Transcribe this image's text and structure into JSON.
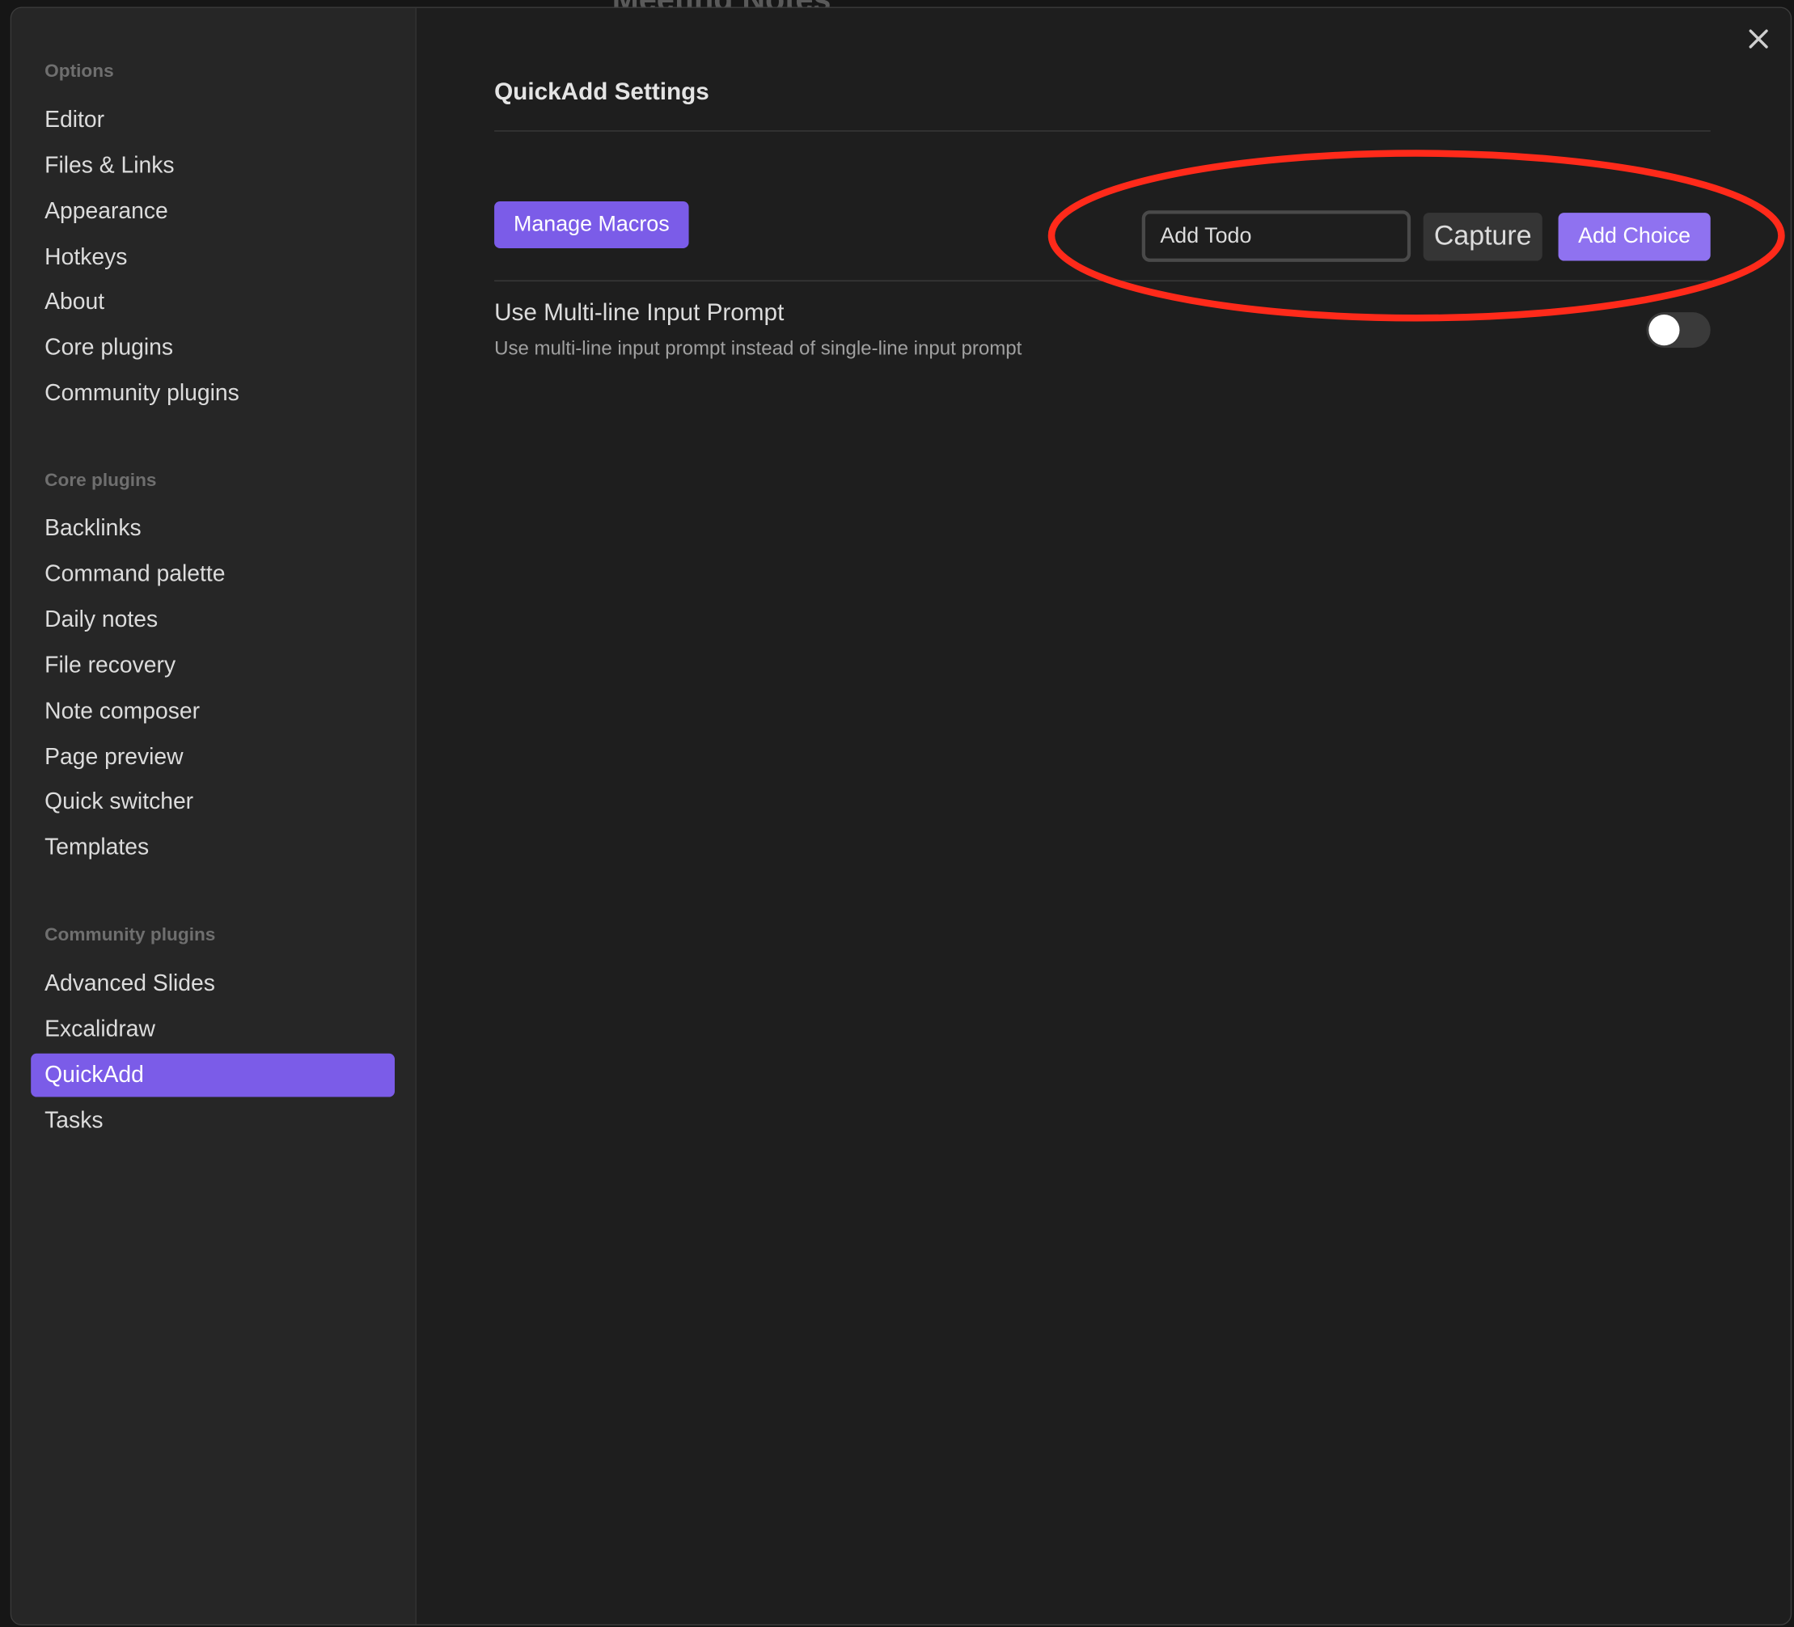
{
  "background_note_title": "Meeting Notes",
  "sidebar": {
    "sections": [
      {
        "title": "Options",
        "items": [
          "Editor",
          "Files & Links",
          "Appearance",
          "Hotkeys",
          "About",
          "Core plugins",
          "Community plugins"
        ]
      },
      {
        "title": "Core plugins",
        "items": [
          "Backlinks",
          "Command palette",
          "Daily notes",
          "File recovery",
          "Note composer",
          "Page preview",
          "Quick switcher",
          "Templates"
        ]
      },
      {
        "title": "Community plugins",
        "items": [
          "Advanced Slides",
          "Excalidraw",
          "QuickAdd",
          "Tasks"
        ]
      }
    ],
    "active_item": "QuickAdd"
  },
  "main": {
    "title": "QuickAdd Settings",
    "manage_macros_label": "Manage Macros",
    "choice_input_value": "Add Todo",
    "choice_type_selected": "Capture",
    "add_choice_label": "Add Choice",
    "setting": {
      "name": "Use Multi-line Input Prompt",
      "description": "Use multi-line input prompt instead of single-line input prompt",
      "enabled": false
    }
  },
  "colors": {
    "accent": "#7b5ce8",
    "annotation": "#ff2a1a",
    "modal_bg": "#1e1e1e",
    "sidebar_bg": "#262626"
  },
  "icons": {
    "close": "close-icon"
  }
}
